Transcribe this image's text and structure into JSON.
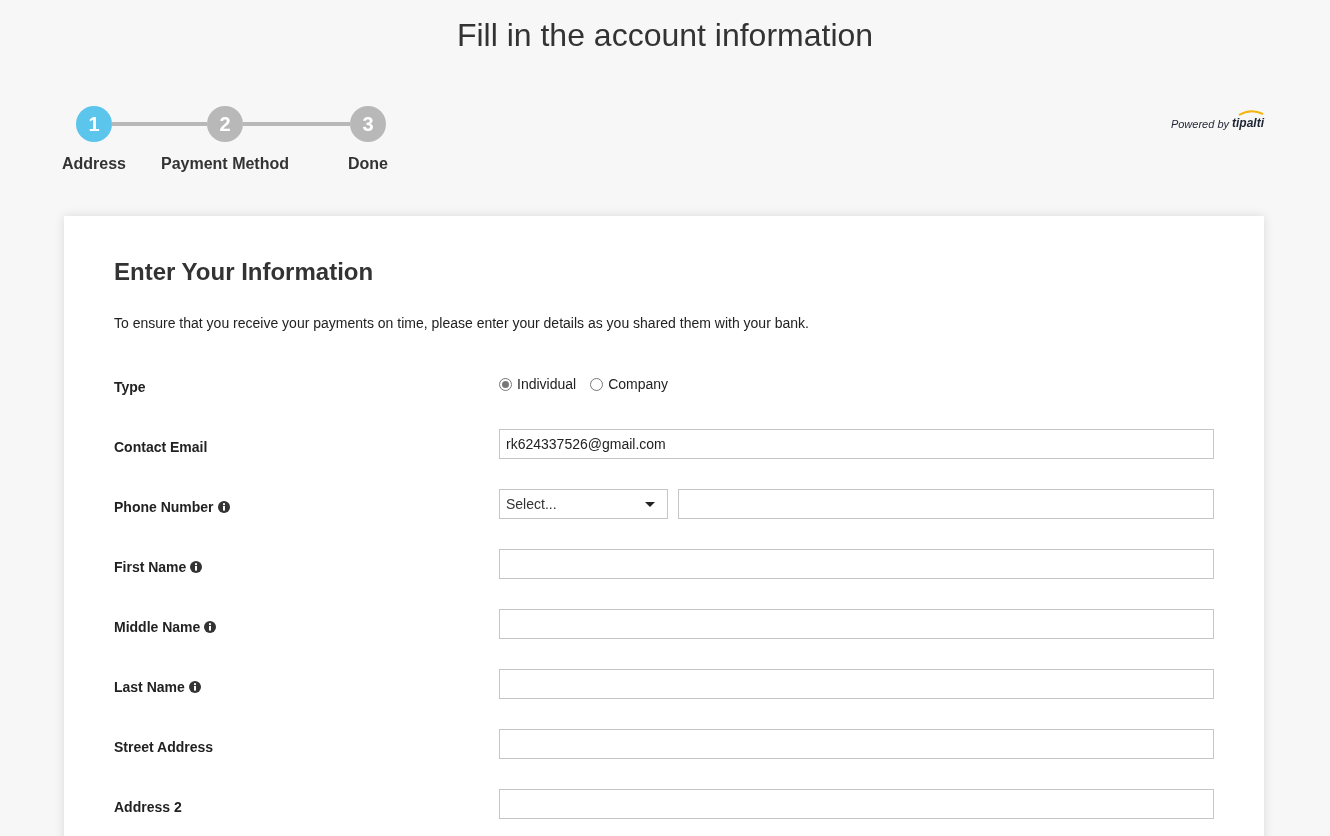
{
  "title": "Fill in the account information",
  "steps": [
    {
      "number": "1",
      "label": "Address",
      "selected": true
    },
    {
      "number": "2",
      "label": "Payment Method",
      "selected": false
    },
    {
      "number": "3",
      "label": "Done",
      "selected": false
    }
  ],
  "powered_by": {
    "text": "Powered by",
    "brand": "tipalti"
  },
  "form": {
    "heading": "Enter Your Information",
    "intro": "To ensure that you receive your payments on time, please enter your details as you shared them with your bank.",
    "fields": [
      {
        "kind": "radio",
        "label": "Type",
        "info": false,
        "options": [
          {
            "label": "Individual",
            "selected": true
          },
          {
            "label": "Company",
            "selected": false
          }
        ]
      },
      {
        "kind": "text",
        "label": "Contact Email",
        "info": false,
        "value": "rk624337526@gmail.com"
      },
      {
        "kind": "phone",
        "label": "Phone Number",
        "info": true,
        "select": "Select..."
      },
      {
        "kind": "text",
        "label": "First Name",
        "info": true
      },
      {
        "kind": "text",
        "label": "Middle Name",
        "info": true
      },
      {
        "kind": "text",
        "label": "Last Name",
        "info": true
      },
      {
        "kind": "text",
        "label": "Street Address",
        "info": false
      },
      {
        "kind": "text",
        "label": "Address 2",
        "info": false
      }
    ]
  }
}
